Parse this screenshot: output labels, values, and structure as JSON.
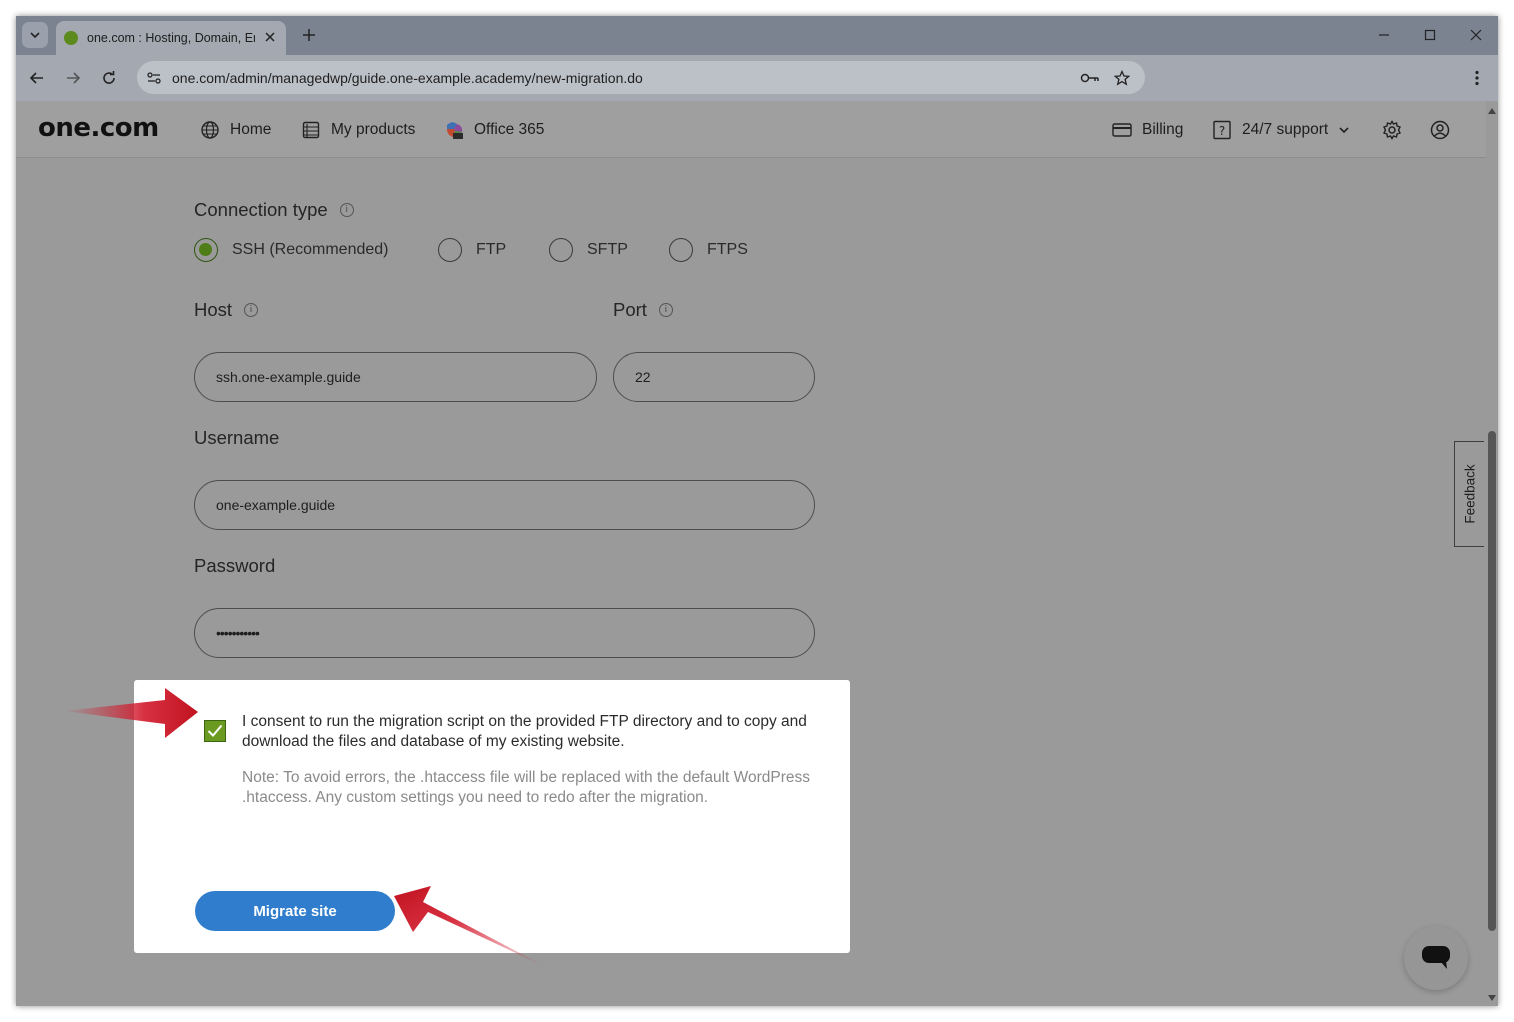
{
  "browser": {
    "tab_title": "one.com : Hosting, Domain, Email",
    "url": "one.com/admin/managedwp/guide.one-example.academy/new-migration.do"
  },
  "header": {
    "logo": "one.com",
    "nav": {
      "home": "Home",
      "products": "My products",
      "office": "Office 365",
      "billing": "Billing",
      "support": "24/7 support"
    }
  },
  "form": {
    "connection_type_label": "Connection type",
    "connection_options": [
      "SSH (Recommended)",
      "FTP",
      "SFTP",
      "FTPS"
    ],
    "selected_connection": "SSH (Recommended)",
    "host_label": "Host",
    "host_value": "ssh.one-example.guide",
    "port_label": "Port",
    "port_value": "22",
    "username_label": "Username",
    "username_value": "one-example.guide",
    "password_label": "Password",
    "password_value": "•••••••••••"
  },
  "consent": {
    "checked": true,
    "text": "I consent to run the migration script on the provided FTP directory and to copy and download the files and database of my existing website.",
    "note": "Note: To avoid errors, the .htaccess file will be replaced with the default WordPress .htaccess. Any custom settings you need to redo after the migration.",
    "button": "Migrate site"
  },
  "feedback_label": "Feedback",
  "colors": {
    "accent_blue": "#2f7dcc",
    "check_green": "#6b9a21",
    "arrow_red": "#d2192c"
  }
}
